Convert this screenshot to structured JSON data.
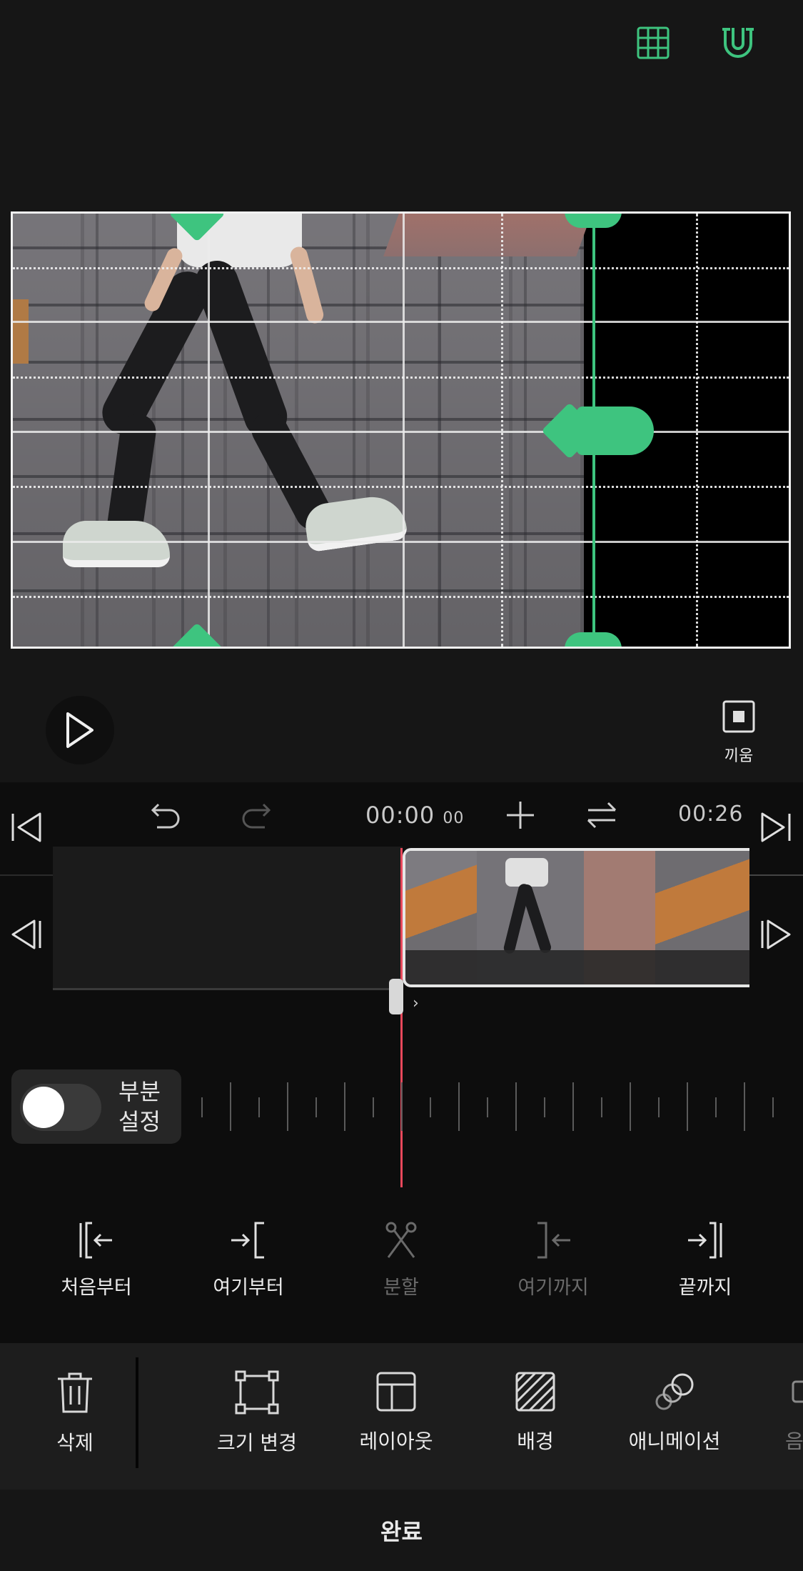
{
  "colors": {
    "accent": "#3ec47f",
    "playhead": "#e8485b",
    "background": "#161616"
  },
  "top_bar": {
    "grid_icon": "grid-icon",
    "magnet_icon": "magnet-icon"
  },
  "player": {
    "play_icon": "play-icon",
    "fit_label": "끼움"
  },
  "timeline": {
    "current_time": "00:00",
    "current_frames": "00",
    "total_time": "00:26"
  },
  "partial_setting": {
    "label_line1": "부분",
    "label_line2": "설정",
    "enabled": false
  },
  "trim_tools": [
    {
      "label": "처음부터",
      "icon": "trim-from-start-icon",
      "enabled": true
    },
    {
      "label": "여기부터",
      "icon": "trim-from-here-icon",
      "enabled": true
    },
    {
      "label": "분할",
      "icon": "split-scissors-icon",
      "enabled": false
    },
    {
      "label": "여기까지",
      "icon": "trim-to-here-icon",
      "enabled": false
    },
    {
      "label": "끝까지",
      "icon": "trim-to-end-icon",
      "enabled": true
    }
  ],
  "toolbar": [
    {
      "label": "삭제",
      "icon": "trash-icon"
    },
    {
      "label": "크기 변경",
      "icon": "resize-icon"
    },
    {
      "label": "레이아웃",
      "icon": "layout-icon"
    },
    {
      "label": "배경",
      "icon": "background-icon"
    },
    {
      "label": "애니메이션",
      "icon": "animation-icon"
    },
    {
      "label": "음",
      "icon": "audio-icon"
    }
  ],
  "done_label": "완료"
}
